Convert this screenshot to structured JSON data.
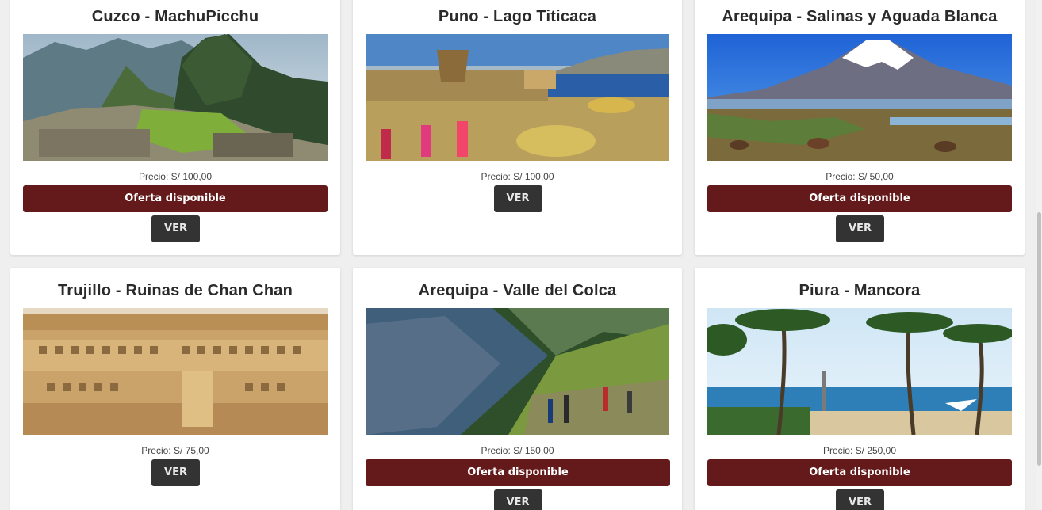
{
  "colors": {
    "offer_bg": "#641a1a",
    "ver_bg": "#333333",
    "page_bg": "#efefef"
  },
  "cards": [
    {
      "title": "Cuzco - MachuPicchu",
      "image_icon": "machu-picchu-photo",
      "price": "Precio: S/ 100,00",
      "offer": "Oferta disponible",
      "ver": "VER"
    },
    {
      "title": "Puno - Lago Titicaca",
      "image_icon": "lake-titicaca-photo",
      "price": "Precio: S/ 100,00",
      "offer": "",
      "ver": "VER"
    },
    {
      "title": "Arequipa - Salinas y Aguada Blanca",
      "image_icon": "salinas-aguada-blanca-photo",
      "price": "Precio: S/ 50,00",
      "offer": "Oferta disponible",
      "ver": "VER"
    },
    {
      "title": "Trujillo - Ruinas de Chan Chan",
      "image_icon": "chan-chan-ruins-photo",
      "price": "Precio: S/ 75,00",
      "offer": "",
      "ver": "VER"
    },
    {
      "title": "Arequipa - Valle del Colca",
      "image_icon": "colca-valley-photo",
      "price": "Precio: S/ 150,00",
      "offer": "Oferta disponible",
      "ver": "VER"
    },
    {
      "title": "Piura - Mancora",
      "image_icon": "mancora-beach-photo",
      "price": "Precio: S/ 250,00",
      "offer": "Oferta disponible",
      "ver": "VER"
    }
  ]
}
